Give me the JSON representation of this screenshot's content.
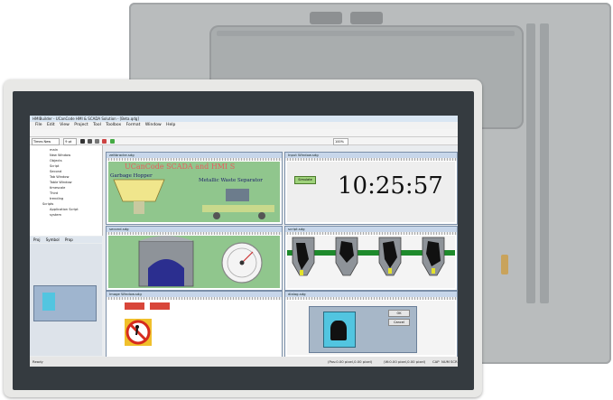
{
  "app": {
    "title": "HMIBuilder - UCanCode HMI & SCADA Solution - [Beta.qdg]",
    "menu": [
      "File",
      "Edit",
      "View",
      "Project",
      "Tool",
      "Toolbox",
      "Format",
      "Window",
      "Help"
    ],
    "font_name": "Times New Roman",
    "font_size": "9 pt",
    "zoom": "100%",
    "status_ready": "Ready",
    "status_pos1": "(Pos:0.00 pixel,0.00 pixel)",
    "status_pos2": "(W:0.00 pixel,0.00 pixel)",
    "status_caps": "CAP",
    "status_num": "NUM",
    "status_scrl": "SCRL"
  },
  "tree": {
    "items": [
      "main",
      "New Window",
      "Objects",
      "Script",
      "Second",
      "Tab Window",
      "Table Window",
      "timescale",
      "Third",
      "trending",
      "Scripts",
      "Application Script",
      "system"
    ],
    "tabs": [
      "Proj",
      "Symbol",
      "Prop"
    ]
  },
  "windows": {
    "w1": {
      "title": "zeitbracke.sdg",
      "headline": "UCanCode SCADA and HMI S",
      "label_left": "Garbage Hopper",
      "label_right": "Metallic Waste Separator"
    },
    "w2": {
      "title": "Input Window.sdg",
      "button": "Simulate",
      "clock": "10:25:57"
    },
    "w3": {
      "title": "second.sdg"
    },
    "w4": {
      "title": "script.sdg"
    },
    "w5": {
      "title": "Image Window.sdg"
    },
    "w6": {
      "title": "dialog.sdg",
      "btn_ok": "OK",
      "btn_cancel": "Cancel"
    }
  },
  "colors": {
    "back_panel": "#b9bcbd",
    "bezel": "#e8e8e6",
    "screen_frame": "#353b40",
    "ui_bg": "#e9ecef",
    "scada_green": "#90c68d",
    "clock_bg": "#eeeeee",
    "silo_gray": "#8e9399",
    "silo_fill": "#2b2e8f",
    "pipe_green": "#1e8a2c",
    "yellow_accent": "#f0e68c",
    "warning_red": "#d8463a"
  },
  "icons": [
    "back-panel-connector",
    "scada-silo",
    "pressure-gauge",
    "valve",
    "no-pedestrian-sign"
  ]
}
